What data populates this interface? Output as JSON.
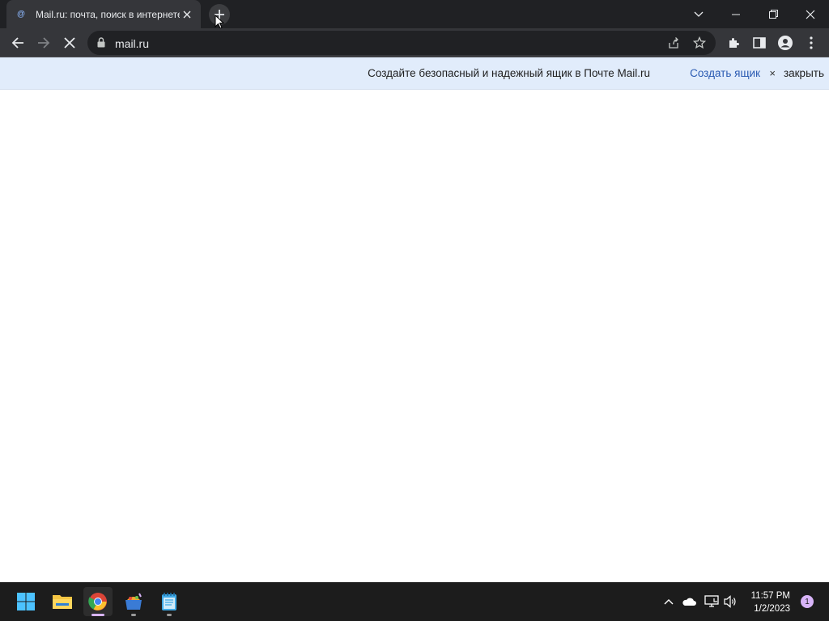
{
  "browser": {
    "tab": {
      "favicon_text": "@",
      "title": "Mail.ru: почта, поиск в интернете"
    },
    "address_bar": {
      "url": "mail.ru"
    },
    "toolbar_icons": [
      "back-icon",
      "forward-icon",
      "stop-icon",
      "lock-icon",
      "share-icon",
      "star-icon",
      "extensions-icon",
      "side-panel-icon",
      "profile-icon",
      "menu-icon"
    ],
    "window_controls": [
      "tab-search-icon",
      "minimize-icon",
      "restore-icon",
      "close-icon"
    ]
  },
  "infobar": {
    "message": "Создайте безопасный и надежный ящик в Почте Mail.ru",
    "cta_label": "Создать ящик",
    "x_glyph": "×",
    "close_label": "закрыть",
    "background": "#e1ecfb",
    "link_color": "#2a5ab2"
  },
  "taskbar": {
    "apps": [
      "windows-start-icon",
      "file-explorer-icon",
      "chrome-icon",
      "app-store-icon",
      "notepad-icon"
    ],
    "tray_icons": [
      "chevron-up-icon",
      "onedrive-cloud-icon",
      "network-icon",
      "volume-icon"
    ],
    "clock": {
      "time": "11:57 PM",
      "date": "1/2/2023"
    },
    "notification_count": "1"
  },
  "colors": {
    "tabstrip": "#202124",
    "toolbar": "#35363a",
    "taskbar": "#1c1c1c"
  }
}
